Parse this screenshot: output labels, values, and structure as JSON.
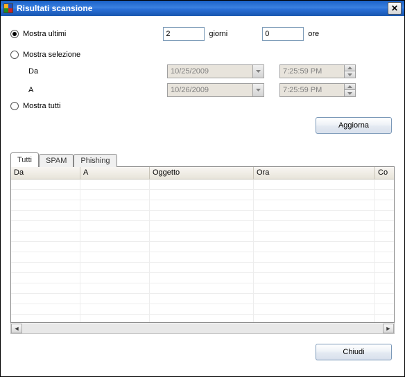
{
  "window_title": "Risultati scansione",
  "close_x": "✕",
  "radios": {
    "show_last": "Mostra ultimi",
    "show_selection": "Mostra selezione",
    "show_all": "Mostra tutti"
  },
  "fields": {
    "days_value": "2",
    "days_label": "giorni",
    "hours_value": "0",
    "hours_label": "ore",
    "from_label": "Da",
    "to_label": "A",
    "from_date": "10/25/2009",
    "to_date": "10/26/2009",
    "from_time": "7:25:59 PM",
    "to_time": "7:25:59 PM"
  },
  "buttons": {
    "refresh": "Aggiorna",
    "close": "Chiudi"
  },
  "tabs": {
    "all": "Tutti",
    "spam": "SPAM",
    "phishing": "Phishing"
  },
  "grid_headers": {
    "from": "Da",
    "to": "A",
    "subject": "Oggetto",
    "time": "Ora",
    "extra": "Co"
  },
  "col_widths": {
    "from": 100,
    "to": 100,
    "subject": 150,
    "time": 175,
    "extra": 29
  }
}
